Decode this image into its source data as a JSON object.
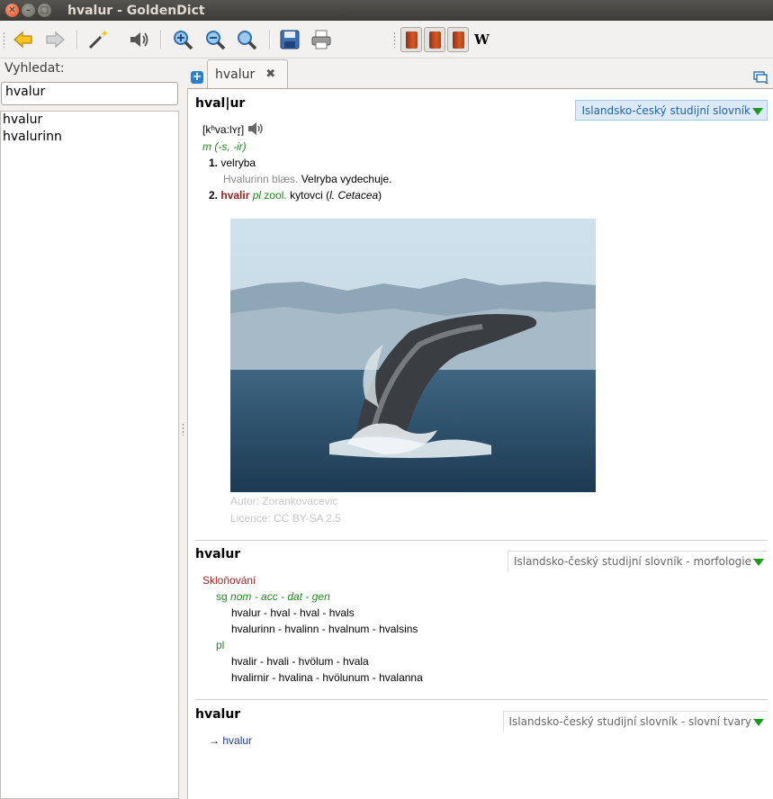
{
  "window": {
    "title": "hvalur - GoldenDict"
  },
  "toolbar": {
    "wiki_label": "W"
  },
  "left": {
    "search_label": "Vyhledat:",
    "search_value": "hvalur",
    "results": [
      "hvalur",
      "hvalurinn"
    ]
  },
  "tab": {
    "label": "hvalur"
  },
  "articles": {
    "a1": {
      "headword": "hval|ur",
      "dict": "Islandsko-český studijní slovník",
      "pron_open": "[kʰva:lʏr̥]",
      "gram": "m (-s, -ir)",
      "sense1_num": "1.",
      "sense1": "velryba",
      "example_is": "Hvalurinn blæs.",
      "example_cs": "Velryba vydechuje.",
      "sense2_num": "2.",
      "sense2_word": "hvalir",
      "sense2_pl": "pl",
      "sense2_zool": "zool.",
      "sense2_text": "kytovci (",
      "sense2_latin_l": "l.",
      "sense2_latin": "Cetacea",
      "sense2_close": ")",
      "img_author": "Autor: Zorankovacevic",
      "img_licence": "Licence: CC BY-SA 2.5"
    },
    "a2": {
      "headword": "hvalur",
      "dict": "Islandsko-český studijní slovník - morfologie",
      "declension": "Skloňování",
      "sg": "sg",
      "cases": "nom - acc - dat - gen",
      "sg_row1": "hvalur - hval - hval - hvals",
      "sg_row2": "hvalurinn - hvalinn - hvalnum - hvalsins",
      "pl": "pl",
      "pl_row1": "hvalir - hvali - hvölum - hvala",
      "pl_row2": "hvalirnir - hvalina - hvölunum - hvalanna"
    },
    "a3": {
      "headword": "hvalur",
      "dict": "Islandsko-český studijní slovník - slovní tvary",
      "arrow": "→",
      "link": "hvalur"
    }
  }
}
